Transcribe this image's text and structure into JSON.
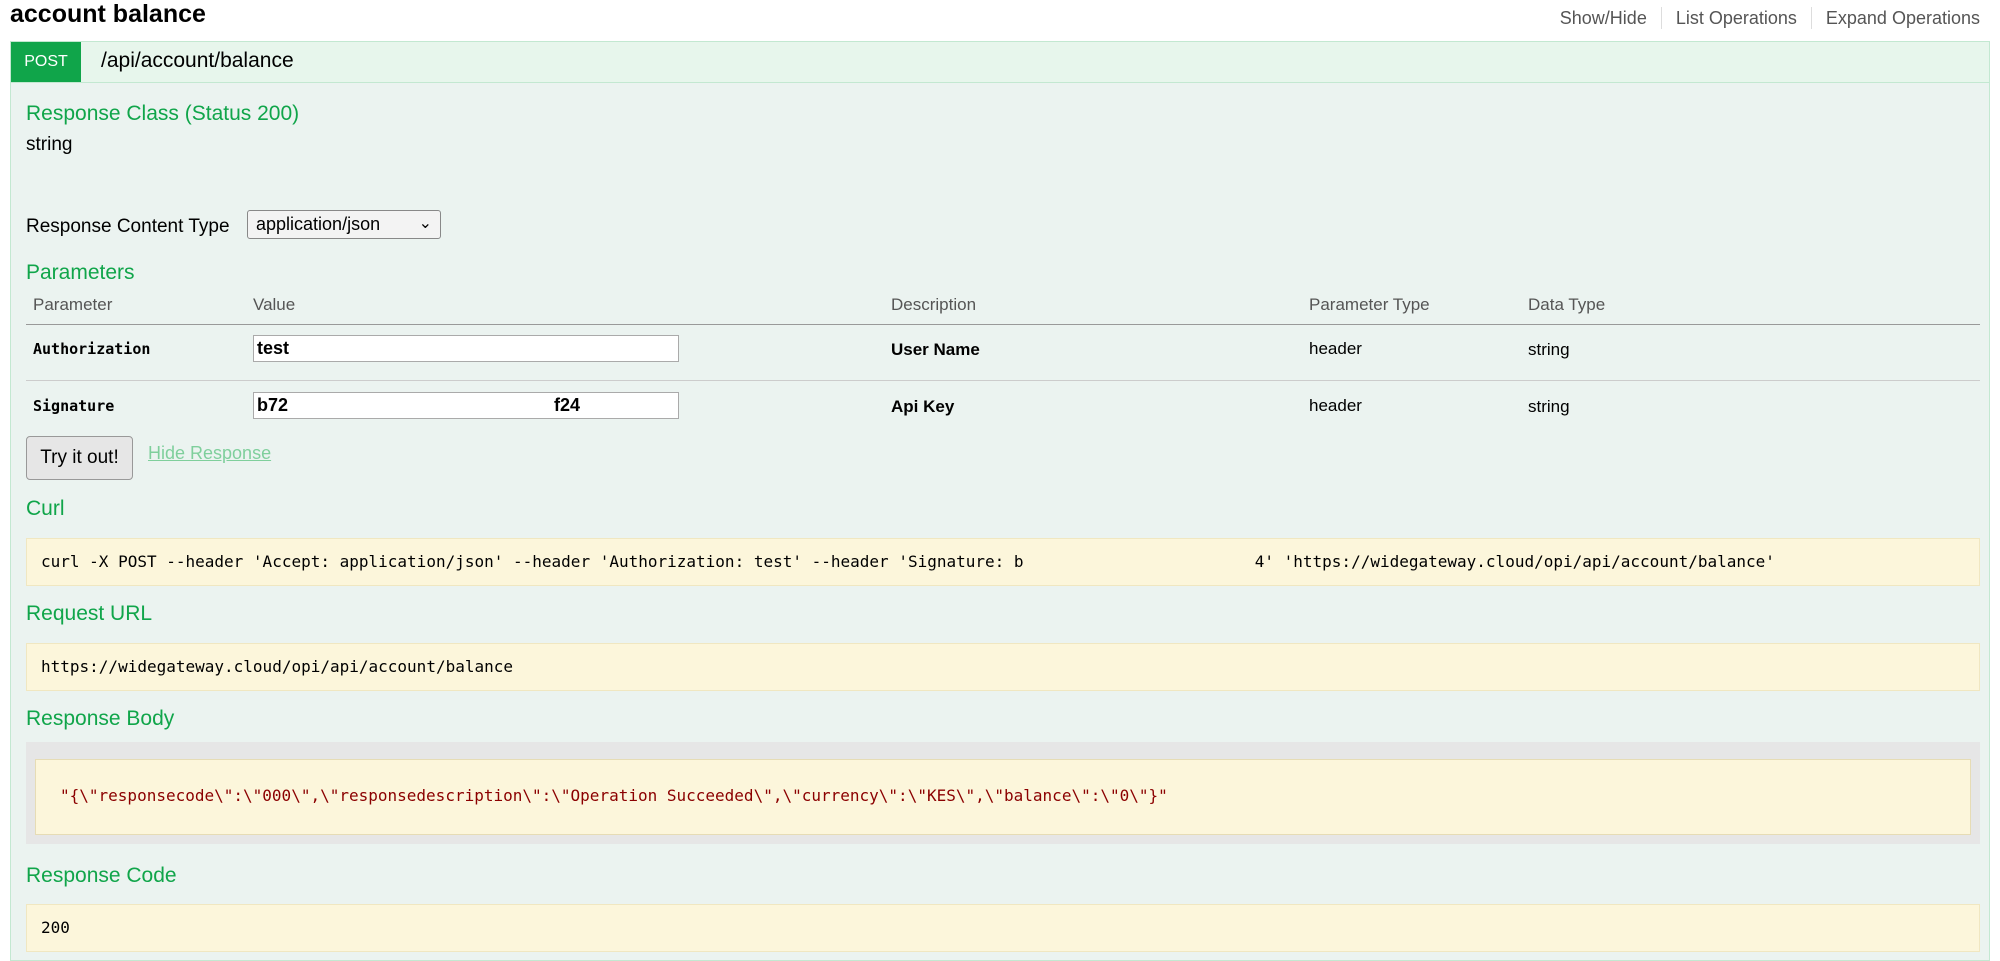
{
  "header": {
    "title": "account balance",
    "links": [
      "Show/Hide",
      "List Operations",
      "Expand Operations"
    ]
  },
  "operation": {
    "method": "POST",
    "path": "/api/account/balance"
  },
  "response_class": {
    "heading": "Response Class (Status 200)",
    "type": "string"
  },
  "content_type": {
    "label": "Response Content Type",
    "selected": "application/json"
  },
  "parameters": {
    "heading": "Parameters",
    "columns": [
      "Parameter",
      "Value",
      "Description",
      "Parameter Type",
      "Data Type"
    ],
    "rows": [
      {
        "name": "Authorization",
        "value": "test",
        "value_tail": "",
        "description": "User Name",
        "param_type": "header",
        "data_type": "string"
      },
      {
        "name": "Signature",
        "value": "b72",
        "value_tail": "f24",
        "description": "Api Key",
        "param_type": "header",
        "data_type": "string"
      }
    ]
  },
  "actions": {
    "try_label": "Try it out!",
    "hide_label": "Hide Response"
  },
  "curl": {
    "heading": "Curl",
    "command": "curl -X POST --header 'Accept: application/json' --header 'Authorization: test' --header 'Signature: b                        4' 'https://widegateway.cloud/opi/api/account/balance'"
  },
  "request_url": {
    "heading": "Request URL",
    "value": "https://widegateway.cloud/opi/api/account/balance"
  },
  "response_body": {
    "heading": "Response Body",
    "value": "\"{\\\"responsecode\\\":\\\"000\\\",\\\"responsedescription\\\":\\\"Operation Succeeded\\\",\\\"currency\\\":\\\"KES\\\",\\\"balance\\\":\\\"0\\\"}\""
  },
  "response_code": {
    "heading": "Response Code",
    "value": "200"
  },
  "colors": {
    "accent": "#10a54a",
    "panel": "#ebf3f0",
    "code_bg": "#fcf6db",
    "body_text": "#8b0000"
  }
}
